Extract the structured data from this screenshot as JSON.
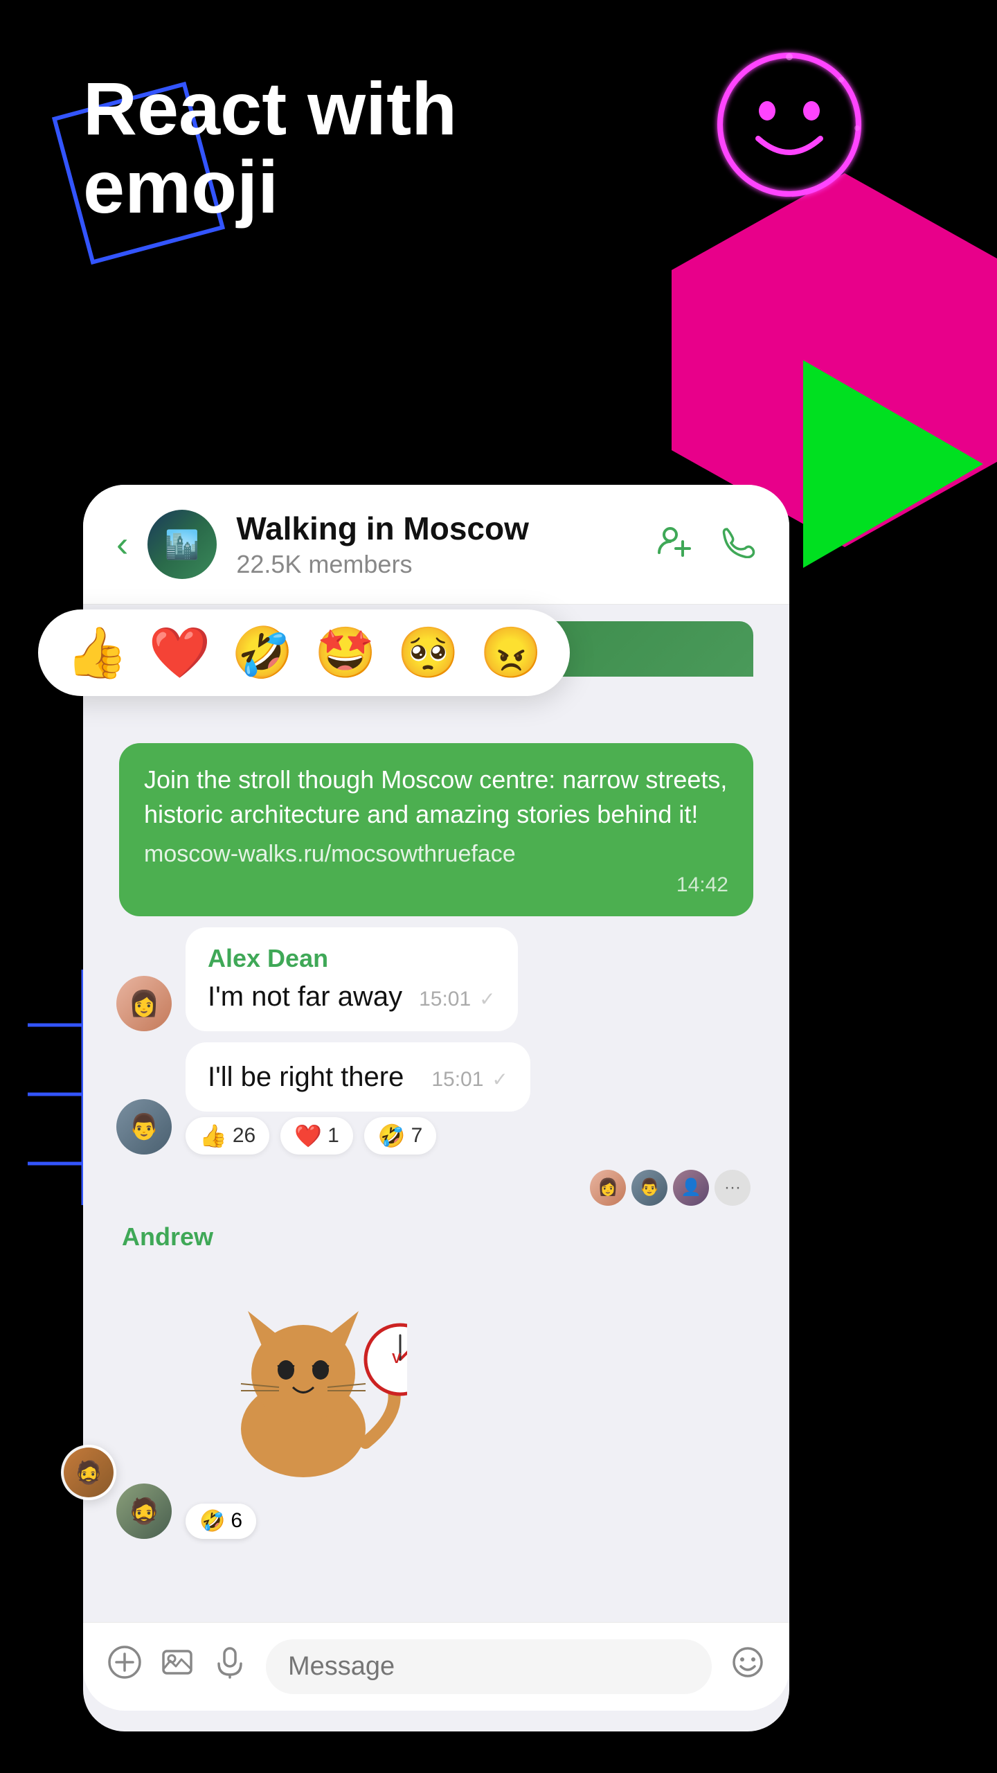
{
  "hero": {
    "title_line1": "React with",
    "title_line2": "emoji"
  },
  "chat": {
    "back_label": "‹",
    "group_name": "Walking in Moscow",
    "members": "22.5K members",
    "add_member_icon": "➕👤",
    "call_icon": "📞",
    "messages": [
      {
        "type": "green",
        "text": "Join the stroll though Moscow centre: narrow streets, historic architecture and amazing stories behind it!",
        "link": "moscow-walks.ru/mocsowthrueface",
        "time": "14:42"
      },
      {
        "type": "incoming",
        "sender": "Alex Dean",
        "sender_color": "#3fa857",
        "text": "I'm not far away",
        "time": "15:01",
        "has_check": true
      },
      {
        "type": "incoming_reactions",
        "text": "I'll be right there",
        "time": "15:01",
        "reactions": [
          {
            "emoji": "👍",
            "count": "26"
          },
          {
            "emoji": "❤️",
            "count": "1"
          },
          {
            "emoji": "🤣",
            "count": "7"
          }
        ]
      },
      {
        "type": "sticker",
        "sender": "Andrew",
        "sender_color": "#3fa857",
        "reaction_emoji": "🤣",
        "reaction_count": "6"
      }
    ]
  },
  "emoji_bar": {
    "emojis": [
      "👍",
      "❤️",
      "🤣",
      "🤩",
      "🥺",
      "😠"
    ]
  },
  "input_bar": {
    "placeholder": "Message",
    "plus_icon": "➕",
    "image_icon": "🖼",
    "mic_icon": "🎤",
    "emoji_icon": "😊"
  }
}
